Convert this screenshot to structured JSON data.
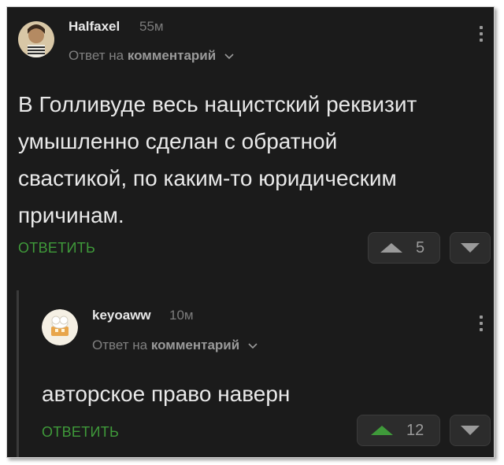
{
  "comments": [
    {
      "username": "Halfaxel",
      "time": "55м",
      "reply_prefix": "Ответ на",
      "reply_target": "комментарий",
      "text_lines": [
        "В Голливуде весь нацистский реквизит",
        "умышленно сделан с обратной",
        "свастикой, по каким-то юридическим",
        "причинам."
      ],
      "reply_label": "ОТВЕТИТЬ",
      "rating": "5",
      "upvote_icon": "triangle-up",
      "downvote_icon": "triangle-down",
      "upvote_color": "#9a9a9a"
    },
    {
      "username": "keyoaww",
      "time": "10м",
      "reply_prefix": "Ответ на",
      "reply_target": "комментарий",
      "text_lines": [
        "авторское право наверн"
      ],
      "reply_label": "ОТВЕТИТЬ",
      "rating": "12",
      "upvote_icon": "triangle-up",
      "downvote_icon": "triangle-down",
      "upvote_color": "#3f9a3a"
    }
  ]
}
